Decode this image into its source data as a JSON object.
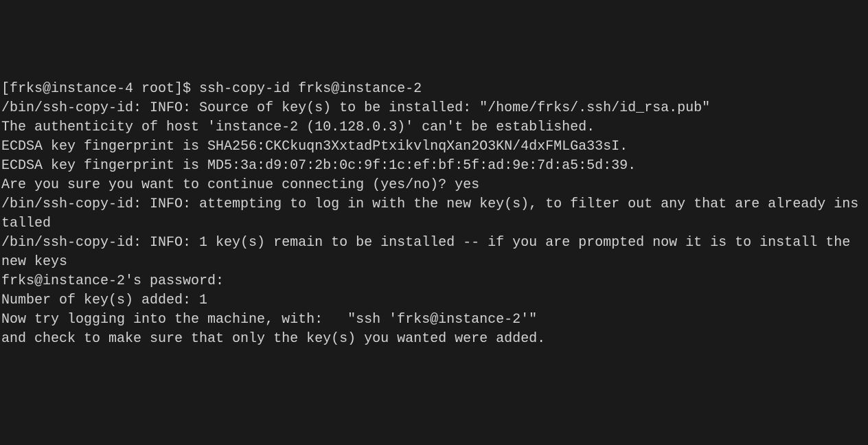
{
  "terminal": {
    "prompt": "[frks@instance-4 root]$ ",
    "command": "ssh-copy-id frks@instance-2",
    "lines": [
      "/bin/ssh-copy-id: INFO: Source of key(s) to be installed: \"/home/frks/.ssh/id_rsa.pub\"",
      "The authenticity of host 'instance-2 (10.128.0.3)' can't be established.",
      "ECDSA key fingerprint is SHA256:CKCkuqn3XxtadPtxikvlnqXan2O3KN/4dxFMLGa33sI.",
      "ECDSA key fingerprint is MD5:3a:d9:07:2b:0c:9f:1c:ef:bf:5f:ad:9e:7d:a5:5d:39.",
      "Are you sure you want to continue connecting (yes/no)? yes",
      "/bin/ssh-copy-id: INFO: attempting to log in with the new key(s), to filter out any that are already installed",
      "/bin/ssh-copy-id: INFO: 1 key(s) remain to be installed -- if you are prompted now it is to install the new keys",
      "frks@instance-2's password:",
      "",
      "Number of key(s) added: 1",
      "",
      "Now try logging into the machine, with:   \"ssh 'frks@instance-2'\"",
      "and check to make sure that only the key(s) you wanted were added."
    ]
  }
}
